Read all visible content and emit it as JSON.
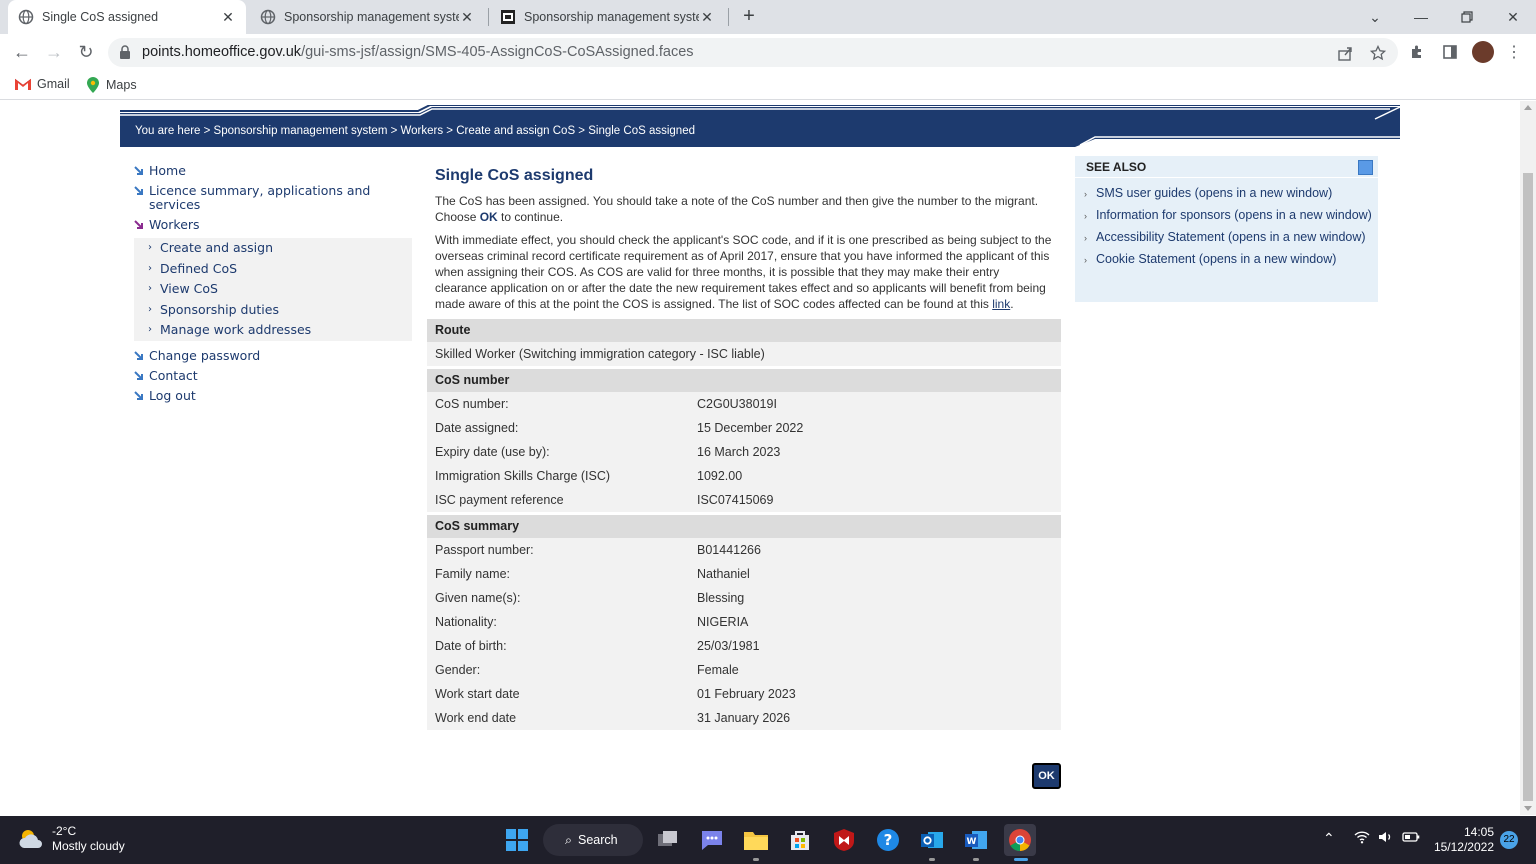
{
  "browser": {
    "tabs": [
      {
        "title": "Single CoS assigned",
        "active": true
      },
      {
        "title": "Sponsorship management system",
        "active": false
      },
      {
        "title": "Sponsorship management system",
        "active": false
      }
    ],
    "url_host": "points.homeoffice.gov.uk",
    "url_path": "/gui-sms-jsf/assign/SMS-405-AssignCoS-CoSAssigned.faces",
    "bookmarks": [
      "Gmail",
      "Maps"
    ]
  },
  "page": {
    "breadcrumb": "You are here > Sponsorship management system > Workers > Create and assign CoS > Single CoS assigned",
    "nav": {
      "home": "Home",
      "licence": "Licence summary, applications and services",
      "workers": "Workers",
      "sub": [
        "Create and assign",
        "Defined CoS",
        "View CoS",
        "Sponsorship duties",
        "Manage work addresses"
      ],
      "change_password": "Change password",
      "contact": "Contact",
      "logout": "Log out"
    },
    "title": "Single CoS assigned",
    "para1_a": "The CoS has been assigned. You should take a note of the CoS number and then give the number to the migrant. Choose ",
    "para1_ok": "OK",
    "para1_b": " to continue.",
    "para2": "With immediate effect, you should check the applicant's SOC code, and if it is one prescribed as being subject to the overseas criminal record certificate requirement as of April 2017, ensure that you have informed the applicant of this when assigning their COS. As COS are valid for three months, it is possible that they may make their entry clearance application on or after the date the new requirement takes effect and so applicants will benefit from being made aware of this at the point the COS is assigned. The list of SOC codes affected can be found at this ",
    "para2_link": "link",
    "para2_end": ".",
    "route": {
      "heading": "Route",
      "value": "Skilled Worker (Switching immigration category - ISC liable)"
    },
    "cos_number": {
      "heading": "CoS number",
      "rows": [
        {
          "k": "CoS number:",
          "v": "C2G0U38019I"
        },
        {
          "k": "Date assigned:",
          "v": "15 December 2022"
        },
        {
          "k": "Expiry date (use by):",
          "v": "16 March 2023"
        },
        {
          "k": "Immigration Skills Charge (ISC)",
          "v": "1092.00"
        },
        {
          "k": "ISC payment reference",
          "v": "ISC07415069"
        }
      ]
    },
    "cos_summary": {
      "heading": "CoS summary",
      "rows": [
        {
          "k": "Passport number:",
          "v": "B01441266"
        },
        {
          "k": "Family name:",
          "v": "Nathaniel"
        },
        {
          "k": "Given name(s):",
          "v": "Blessing"
        },
        {
          "k": "Nationality:",
          "v": "NIGERIA"
        },
        {
          "k": "Date of birth:",
          "v": "25/03/1981"
        },
        {
          "k": "Gender:",
          "v": "Female"
        },
        {
          "k": "Work start date",
          "v": "01 February 2023"
        },
        {
          "k": "Work end date",
          "v": "31 January 2026"
        }
      ]
    },
    "ok_label": "OK",
    "see_also": {
      "heading": "SEE ALSO",
      "links": [
        "SMS user guides (opens in a new window)",
        "Information for sponsors (opens in a new window)",
        "Accessibility Statement (opens in a new window)",
        "Cookie Statement (opens in a new window)"
      ]
    }
  },
  "taskbar": {
    "temp": "-2°C",
    "weather": "Mostly cloudy",
    "search": "Search",
    "time": "14:05",
    "date": "15/12/2022",
    "notifications": "22"
  },
  "colors": {
    "navy": "#1d3a6e",
    "section_bg": "#f2f2f2",
    "header_bg": "#dcdcdc"
  }
}
